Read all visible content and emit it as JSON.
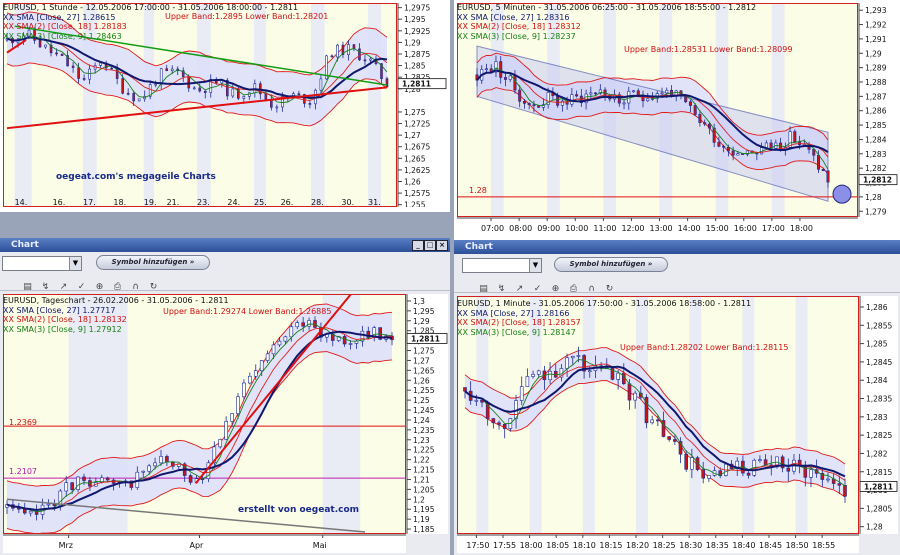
{
  "colors": {
    "up": "#ffffff",
    "down": "#c81414",
    "candle": "#1a2a9a",
    "sma27": "#10186e",
    "sma18": "#e02020",
    "sma9": "#18801a",
    "bandLine": "#e01818",
    "bandFill": "#dcdffa",
    "trendUp": "#e01010",
    "trendDn": "#129c12",
    "trendGray": "#777777",
    "level": "#e01010",
    "level2": "#c020b0",
    "lastMarker": "#111111"
  },
  "charts": [
    {
      "id": "p1",
      "legend": {
        "title": "EURUSD, 1 Stunde - 12.05.2006 17:00:00 - 31.05.2006 18:00:00 - 1.2811",
        "sma27": "XX SMA [Close, 27] 1.28615",
        "sma18": "XX SMA(2) [Close, 18] 1.28183",
        "sma9": "XX SMA(3) [Close, 9] 1.28463"
      },
      "band_text": "Upper Band:1.2895 Lower Band:1.28201",
      "watermark": "oegeat.com's megageile Charts",
      "last_label": "1,2811",
      "chart_data": {
        "type": "candlestick",
        "title": "EURUSD, 1 Stunde - 12.05.2006 17:00:00 - 31.05.2006 18:00:00 - 1.2811",
        "xticks": [
          "14.",
          "16.",
          "17.",
          "18.",
          "19.",
          "21.",
          "23.",
          "24.",
          "25.",
          "26.",
          "28.",
          "30.",
          "31."
        ],
        "yticks": [
          "1,2975",
          "1,295",
          "1,2925",
          "1,29",
          "1,2875",
          "1,285",
          "1,2825",
          "1,28",
          "1,275",
          "1,2725",
          "1,27",
          "1,2675",
          "1,265",
          "1,2625",
          "1,26",
          "1,2575",
          "1,255"
        ],
        "ylim": [
          1.2545,
          1.2985
        ],
        "anchors": [
          [
            0,
            1.2905
          ],
          [
            0.05,
            1.292
          ],
          [
            0.1,
            1.2888
          ],
          [
            0.15,
            1.286
          ],
          [
            0.2,
            1.2815
          ],
          [
            0.25,
            1.2865
          ],
          [
            0.3,
            1.2805
          ],
          [
            0.35,
            1.2775
          ],
          [
            0.4,
            1.283
          ],
          [
            0.45,
            1.2835
          ],
          [
            0.5,
            1.2795
          ],
          [
            0.55,
            1.2815
          ],
          [
            0.6,
            1.2785
          ],
          [
            0.65,
            1.2805
          ],
          [
            0.7,
            1.2765
          ],
          [
            0.75,
            1.2785
          ],
          [
            0.8,
            1.2775
          ],
          [
            0.85,
            1.288
          ],
          [
            0.9,
            1.2885
          ],
          [
            0.95,
            1.2865
          ],
          [
            1,
            1.2811
          ]
        ],
        "levels": [],
        "trends": [
          {
            "color": "trendUp",
            "from": [
              0,
              1.2715
            ],
            "to": [
              1,
              1.2803
            ],
            "width": 2
          },
          {
            "color": "trendUp",
            "from": [
              0,
              1.2878
            ],
            "to": [
              0.05,
              1.2905
            ],
            "width": 2
          },
          {
            "color": "trendDn",
            "from": [
              0.02,
              1.2935
            ],
            "to": [
              1,
              1.2808
            ],
            "width": 1.5
          }
        ],
        "bandWidth": 0.0055,
        "noise": 0.0013,
        "n": 70,
        "seed": 11,
        "x_positions": [
          0.02,
          0.12,
          0.2,
          0.28,
          0.36,
          0.42,
          0.5,
          0.58,
          0.65,
          0.72,
          0.8,
          0.88,
          0.95
        ]
      }
    },
    {
      "id": "p2",
      "legend": {
        "title": "EURUSD, 5 Minuten - 31.05.2006 06:25:00 - 31.05.2006 18:55:00 - 1.2812",
        "sma27": "XX SMA [Close, 27] 1.28316",
        "sma18": "XX SMA(2) [Close, 18] 1.28312",
        "sma9": "XX SMA(3) [Close, 9] 1.28237"
      },
      "band_text": "Upper Band:1.28531 Lower Band:1.28099",
      "level_label": "1.28",
      "last_label": "1,2812",
      "chart_data": {
        "type": "candlestick",
        "title": "EURUSD, 5 Minuten - 31.05.2006 06:25:00 - 31.05.2006 18:55:00 - 1.2812",
        "xticks": [
          "07:00",
          "08:00",
          "09:00",
          "10:00",
          "11:00",
          "12:00",
          "13:00",
          "14:00",
          "15:00",
          "16:00",
          "17:00",
          "18:00"
        ],
        "yticks": [
          "1,293",
          "1,292",
          "1,291",
          "1,29",
          "1,289",
          "1,288",
          "1,287",
          "1,286",
          "1,285",
          "1,284",
          "1,283",
          "1,282",
          "1,281",
          "1,28",
          "1,279"
        ],
        "ylim": [
          1.2786,
          1.2935
        ],
        "anchors": [
          [
            0,
            1.2885
          ],
          [
            0.05,
            1.2892
          ],
          [
            0.1,
            1.2878
          ],
          [
            0.15,
            1.2862
          ],
          [
            0.2,
            1.2869
          ],
          [
            0.25,
            1.2866
          ],
          [
            0.3,
            1.287
          ],
          [
            0.35,
            1.2875
          ],
          [
            0.4,
            1.2866
          ],
          [
            0.45,
            1.287
          ],
          [
            0.5,
            1.2872
          ],
          [
            0.55,
            1.2874
          ],
          [
            0.6,
            1.2862
          ],
          [
            0.65,
            1.285
          ],
          [
            0.7,
            1.2835
          ],
          [
            0.75,
            1.2832
          ],
          [
            0.8,
            1.2833
          ],
          [
            0.85,
            1.2836
          ],
          [
            0.9,
            1.2842
          ],
          [
            0.95,
            1.283
          ],
          [
            1,
            1.2812
          ]
        ],
        "levels": [
          {
            "y": 1.28,
            "color": "level"
          }
        ],
        "trends": [],
        "channel": {
          "upper": [
            [
              0,
              1.2905
            ],
            [
              1,
              1.2845
            ]
          ],
          "lower": [
            [
              0,
              1.287
            ],
            [
              1,
              1.2797
            ]
          ]
        },
        "bandWidth": 0.0012,
        "noise": 0.0005,
        "n": 75,
        "seed": 23,
        "x_positions": [
          0.04,
          0.12,
          0.2,
          0.28,
          0.36,
          0.44,
          0.52,
          0.6,
          0.68,
          0.76,
          0.84,
          0.92
        ]
      }
    },
    {
      "id": "p3",
      "window_title": "Chart",
      "symbol_button": "Symbol hinzufügen »",
      "legend": {
        "title": "EURUSD, Tageschart - 26.02.2006 - 31.05.2006 - 1.2811",
        "sma27": "XX SMA [Close, 27] 1.27717",
        "sma18": "XX SMA(2) [Close, 18] 1.28132",
        "sma9": "XX SMA(3) [Close, 9] 1.27912"
      },
      "band_text": "Upper Band:1.29274 Lower Band:1.26885",
      "watermark": "erstellt von oegeat.com",
      "level_labels": [
        "1.2369",
        "1.2107"
      ],
      "last_label": "1,2811",
      "chart_data": {
        "type": "candlestick",
        "title": "EURUSD, Tageschart - 26.02.2006 - 31.05.2006 - 1.2811",
        "xticks": [
          "Mrz",
          "Apr",
          "Mai"
        ],
        "yticks": [
          "1,3",
          "1,295",
          "1,29",
          "1,285",
          "1,28",
          "1,275",
          "1,27",
          "1,265",
          "1,26",
          "1,255",
          "1,25",
          "1,245",
          "1,24",
          "1,235",
          "1,23",
          "1,225",
          "1,22",
          "1,215",
          "1,21",
          "1,205",
          "1,2",
          "1,195",
          "1,19",
          "1,185"
        ],
        "ylim": [
          1.1825,
          1.3035
        ],
        "anchors": [
          [
            0,
            1.196
          ],
          [
            0.05,
            1.19
          ],
          [
            0.1,
            1.196
          ],
          [
            0.15,
            1.205
          ],
          [
            0.2,
            1.211
          ],
          [
            0.25,
            1.208
          ],
          [
            0.3,
            1.205
          ],
          [
            0.35,
            1.214
          ],
          [
            0.4,
            1.22
          ],
          [
            0.45,
            1.214
          ],
          [
            0.5,
            1.21
          ],
          [
            0.55,
            1.232
          ],
          [
            0.6,
            1.252
          ],
          [
            0.65,
            1.265
          ],
          [
            0.7,
            1.278
          ],
          [
            0.75,
            1.293
          ],
          [
            0.8,
            1.284
          ],
          [
            0.85,
            1.282
          ],
          [
            0.9,
            1.28
          ],
          [
            0.95,
            1.284
          ],
          [
            1,
            1.2811
          ]
        ],
        "levels": [
          {
            "y": 1.2369,
            "color": "level"
          },
          {
            "y": 1.2107,
            "color": "level2"
          }
        ],
        "trends": [
          {
            "color": "trendUp",
            "from": [
              0.49,
              1.208
            ],
            "to": [
              0.9,
              1.305
            ],
            "width": 2
          },
          {
            "color": "trendGray",
            "from": [
              0,
              1.2
            ],
            "to": [
              0.93,
              1.1835
            ],
            "width": 1.5
          }
        ],
        "bandWidth": 0.012,
        "noise": 0.0035,
        "n": 66,
        "seed": 37,
        "x_positions": [
          0.16,
          0.5,
          0.82
        ]
      }
    },
    {
      "id": "p4",
      "window_title": "Chart",
      "symbol_button": "Symbol hinzufügen »",
      "legend": {
        "title": "EURUSD, 1 Minute - 31.05.2006 17:50:00 - 31.05.2006 18:58:00 - 1.2811",
        "sma27": "XX SMA [Close, 27] 1.28166",
        "sma18": "XX SMA(2) [Close, 18] 1.28157",
        "sma9": "XX SMA(3) [Close, 9] 1.28147"
      },
      "band_text": "Upper Band:1.28202 Lower Band:1.28115",
      "last_label": "1,2811",
      "chart_data": {
        "type": "candlestick",
        "title": "EURUSD, 1 Minute - 31.05.2006 17:50:00 - 31.05.2006 18:58:00 - 1.2811",
        "xticks": [
          "17:50",
          "17:55",
          "18:00",
          "18:05",
          "18:10",
          "18:15",
          "18:20",
          "18:25",
          "18:30",
          "18:35",
          "18:40",
          "18:45",
          "18:50",
          "18:55"
        ],
        "yticks": [
          "1,286",
          "1,2855",
          "1,285",
          "1,2845",
          "1,284",
          "1,2835",
          "1,283",
          "1,2825",
          "1,282",
          "1,2815",
          "1,281",
          "1,2805",
          "1,28"
        ],
        "ylim": [
          1.2798,
          1.2863
        ],
        "anchors": [
          [
            0,
            1.2838
          ],
          [
            0.06,
            1.2832
          ],
          [
            0.1,
            1.2826
          ],
          [
            0.15,
            1.2838
          ],
          [
            0.2,
            1.2842
          ],
          [
            0.25,
            1.2844
          ],
          [
            0.3,
            1.2845
          ],
          [
            0.35,
            1.2842
          ],
          [
            0.4,
            1.284
          ],
          [
            0.45,
            1.2835
          ],
          [
            0.5,
            1.2828
          ],
          [
            0.55,
            1.2822
          ],
          [
            0.6,
            1.2816
          ],
          [
            0.65,
            1.2813
          ],
          [
            0.7,
            1.2815
          ],
          [
            0.75,
            1.2816
          ],
          [
            0.8,
            1.2816
          ],
          [
            0.85,
            1.2817
          ],
          [
            0.9,
            1.2816
          ],
          [
            0.95,
            1.2813
          ],
          [
            1,
            1.2811
          ]
        ],
        "levels": [],
        "trends": [],
        "bandWidth": 0.00045,
        "noise": 0.00028,
        "n": 68,
        "seed": 53,
        "x_positions": [
          0.03,
          0.1,
          0.17,
          0.24,
          0.31,
          0.38,
          0.45,
          0.52,
          0.59,
          0.66,
          0.73,
          0.8,
          0.87,
          0.94
        ]
      }
    }
  ]
}
